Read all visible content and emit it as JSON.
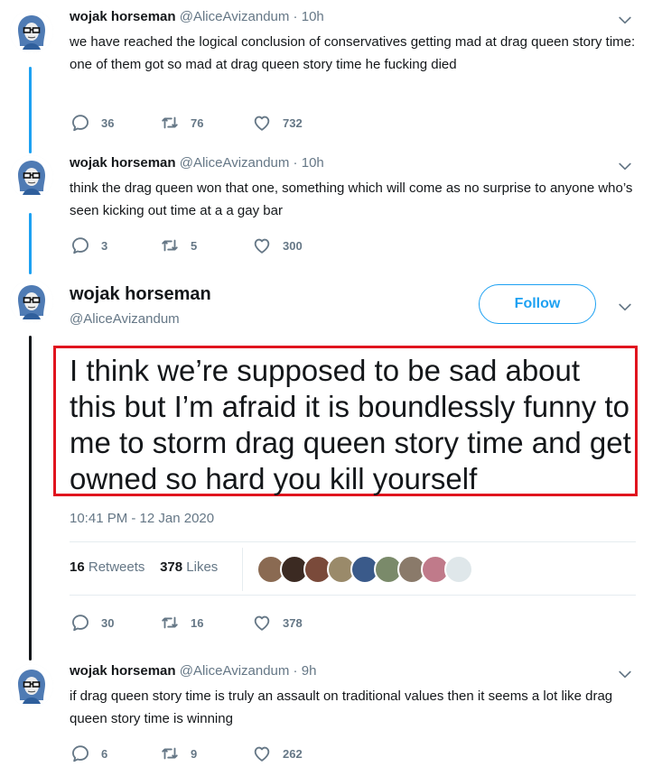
{
  "tweets": [
    {
      "name": "wojak horseman",
      "handle": "@AliceAvizandum",
      "time": " · 10h",
      "text": "we have reached the logical conclusion of conservatives getting mad at drag queen story time: one of them got so mad at drag queen story time he fucking died",
      "replies": "36",
      "retweets": "76",
      "likes": "732"
    },
    {
      "name": "wojak horseman",
      "handle": "@AliceAvizandum",
      "time": " · 10h",
      "text": "think the drag queen won that one, something which will come as no surprise to anyone who’s seen kicking out time at a a gay bar",
      "replies": "3",
      "retweets": "5",
      "likes": "300"
    },
    {
      "name": "wojak horseman",
      "handle": "@AliceAvizandum",
      "time": " · 9h",
      "text": "if drag queen story time is truly an assault on traditional values then it seems a lot like drag queen story time is winning",
      "replies": "6",
      "retweets": "9",
      "likes": "262"
    }
  ],
  "focused": {
    "name": "wojak horseman",
    "handle": "@AliceAvizandum",
    "follow_label": "Follow",
    "text": "I think we’re supposed to be sad about this but I’m afraid it is boundlessly funny to me to storm drag queen story time and get owned so hard you kill yourself",
    "timestamp": "10:41 PM - 12 Jan 2020",
    "retweet_count": "16",
    "retweet_label": "Retweets",
    "like_count": "378",
    "like_label": "Likes",
    "replies": "30",
    "retweets": "16",
    "likes": "378"
  },
  "colors": {
    "accent": "#1da1f2",
    "highlight_box": "#e0141e",
    "muted": "#657786"
  },
  "icons": [
    "reply-icon",
    "retweet-icon",
    "like-icon",
    "chevron-down-icon"
  ]
}
